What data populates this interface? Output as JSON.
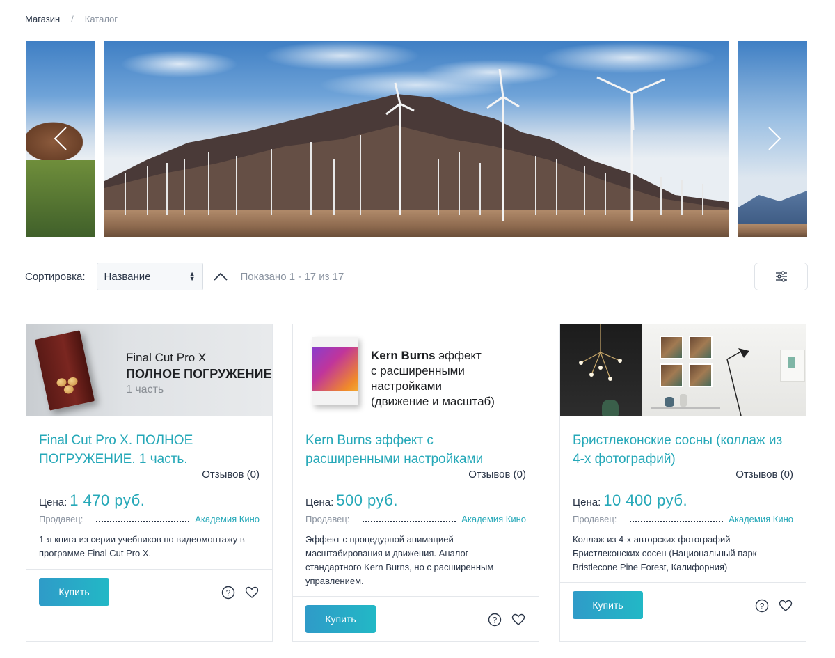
{
  "breadcrumb": {
    "home": "Магазин",
    "separator": "/",
    "current": "Каталог"
  },
  "slider": {
    "prev_icon": "chevron-left-icon",
    "next_icon": "chevron-right-icon"
  },
  "toolbar": {
    "sort_label": "Сортировка:",
    "sort_value": "Название",
    "shown_text": "Показано 1 - 17 из 17",
    "sort_direction_icon": "chevron-up-icon",
    "filter_icon": "sliders-icon"
  },
  "products": [
    {
      "image_text": {
        "line1": "Final Cut Pro X",
        "line2": "ПОЛНОЕ ПОГРУЖЕНИЕ",
        "line3": "1 часть"
      },
      "title": "Final Cut Pro X. ПОЛНОЕ ПОГРУЖЕНИЕ. 1 часть.",
      "reviews": "Отзывов (0)",
      "price_label": "Цена:",
      "price": "1 470 руб.",
      "seller_label": "Продавец:",
      "seller": "Академия Кино",
      "description": "1-я книга из серии учебников по видеомонтажу в программе Final Cut Pro X.",
      "buy_label": "Купить"
    },
    {
      "image_text": {
        "line1_bold": "Kern Burns",
        "line1_rest": " эффект",
        "line2": "с расширенными настройками",
        "line3": "(движение и масштаб)"
      },
      "title": "Kern Burns эффект с расширенными настройками",
      "reviews": "Отзывов (0)",
      "price_label": "Цена:",
      "price": "500 руб.",
      "seller_label": "Продавец:",
      "seller": "Академия Кино",
      "description": "Эффект с процедурной анимацией масштабирования и движения. Аналог стандартного Kern Burns, но с расширенным управлением.",
      "buy_label": "Купить"
    },
    {
      "title": "Бристлеконские сосны (коллаж из 4-х фотографий)",
      "reviews": "Отзывов (0)",
      "price_label": "Цена:",
      "price": "10 400 руб.",
      "seller_label": "Продавец:",
      "seller": "Академия Кино",
      "description": "Коллаж из 4-х авторских фотографий Бристлеконских сосен (Национальный парк Bristlecone Pine Forest, Калифорния)",
      "buy_label": "Купить"
    }
  ],
  "colors": {
    "accent": "#25a8b8",
    "button_start": "#2f9bc8",
    "button_end": "#22b8c6",
    "text": "#2a3547",
    "muted": "#8a93a0"
  }
}
